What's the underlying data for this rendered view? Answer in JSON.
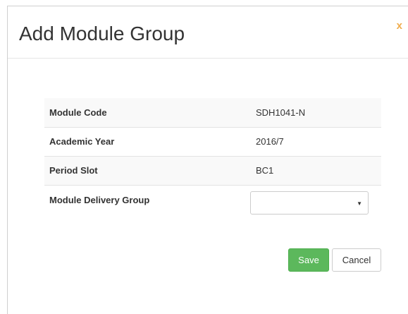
{
  "dialog": {
    "title": "Add Module Group",
    "close_label": "x"
  },
  "details": [
    {
      "label": "Module Code",
      "value": "SDH1041-N"
    },
    {
      "label": "Academic Year",
      "value": "2016/7"
    },
    {
      "label": "Period Slot",
      "value": "BC1"
    }
  ],
  "delivery_group": {
    "label": "Module Delivery Group",
    "selected_value": ""
  },
  "actions": {
    "save_label": "Save",
    "cancel_label": "Cancel"
  },
  "colors": {
    "save_green": "#5cb85c",
    "close_orange": "#f0ad4e"
  }
}
